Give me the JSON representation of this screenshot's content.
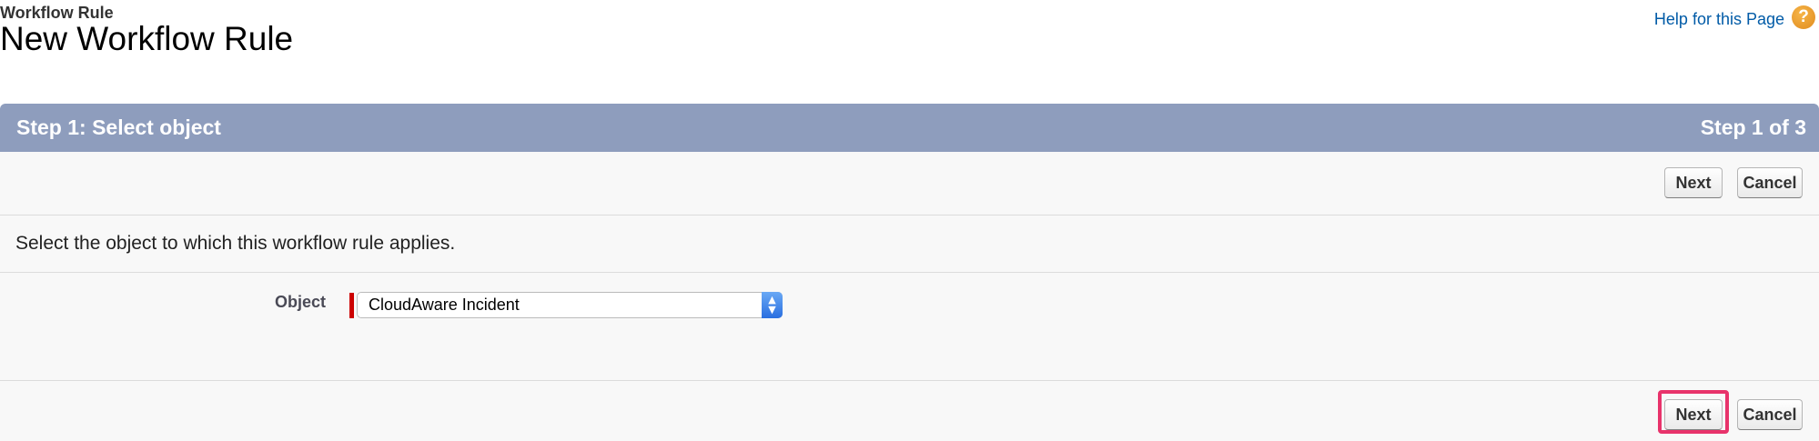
{
  "header": {
    "breadcrumb": "Workflow Rule",
    "title": "New Workflow Rule",
    "help_link": "Help for this Page",
    "help_icon": "?"
  },
  "step_bar": {
    "title": "Step 1: Select object",
    "count": "Step 1 of 3"
  },
  "buttons": {
    "next": "Next",
    "cancel": "Cancel"
  },
  "instruction": "Select the object to which this workflow rule applies.",
  "field": {
    "label": "Object",
    "selected_value": "CloudAware Incident",
    "required": true
  },
  "colors": {
    "step_bar": "#8e9dbd",
    "help_link": "#015ba7",
    "required_marker": "#cc0000",
    "highlight": "#e8336b"
  },
  "icons": {
    "help": "help-icon",
    "select_arrows": "chevron-up-down-icon"
  }
}
